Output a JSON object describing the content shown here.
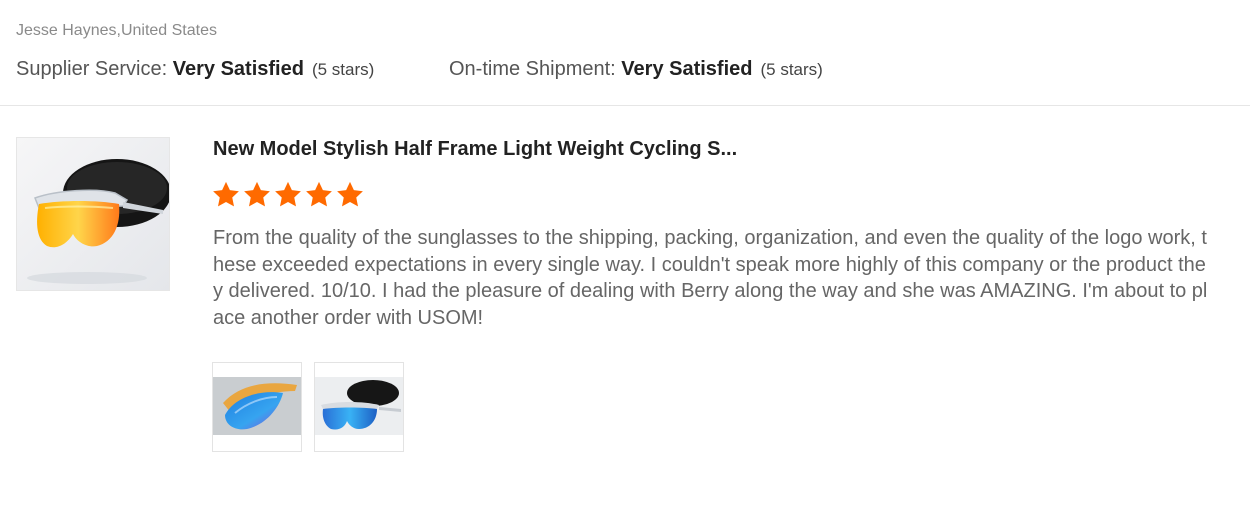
{
  "reviewer": {
    "name_location": "Jesse Haynes,United States"
  },
  "ratings": [
    {
      "label": "Supplier Service: ",
      "value": "Very Satisfied",
      "stars_note": "(5 stars)"
    },
    {
      "label": "On-time Shipment: ",
      "value": "Very Satisfied",
      "stars_note": "(5 stars)"
    }
  ],
  "product": {
    "title": "New Model Stylish Half Frame Light Weight Cycling S...",
    "image_icon": "sunglasses-product-photo",
    "rating_stars": 5
  },
  "review": {
    "text": "From the quality of the sunglasses to the shipping, packing, organization, and even the quality of the logo work, these exceeded expectations in every single way. I couldn't speak more highly of this company or the product they delivered. 10/10. I had the pleasure of dealing with Berry along the way and she was AMAZING. I'm about to place another order with USOM!"
  },
  "attachments": [
    {
      "icon": "sunglasses-blue-lens-photo"
    },
    {
      "icon": "sunglasses-with-case-photo"
    }
  ],
  "colors": {
    "star": "#ff6a00",
    "divider": "#e6e6e6",
    "muted_text": "#8a8a8a",
    "body_text": "#666666"
  }
}
